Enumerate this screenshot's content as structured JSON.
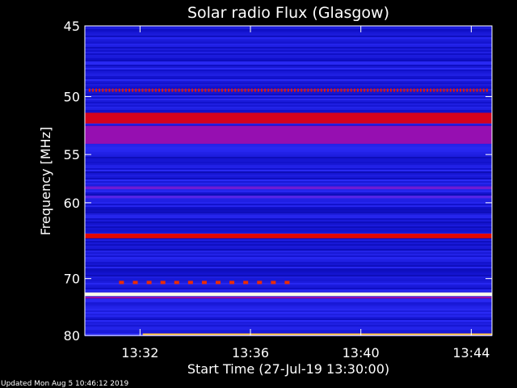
{
  "chart_data": {
    "type": "heatmap",
    "title": "Solar radio Flux (Glasgow)",
    "xlabel": "Start Time (27-Jul-19 13:30:00)",
    "ylabel": "Frequency [MHz]",
    "x_ticks": [
      "13:32",
      "13:36",
      "13:40",
      "13:44"
    ],
    "x_tick_minutes": [
      2,
      6,
      10,
      14
    ],
    "xlim_minutes": [
      0,
      14.75
    ],
    "y_ticks": [
      45,
      50,
      55,
      60,
      70,
      80
    ],
    "ylim": [
      45,
      80
    ],
    "y_scale": "reciprocal",
    "background_colour": "#1b1bd0",
    "colormap": [
      "#000060",
      "#1010c8",
      "#3030ff",
      "#9010c0",
      "#e00000",
      "#ff8000",
      "#ffe060",
      "#ffffff"
    ],
    "features": [
      {
        "kind": "band",
        "freq_start": 51.3,
        "freq_end": 52.2,
        "level": 0.55
      },
      {
        "kind": "band",
        "freq_start": 52.4,
        "freq_end": 54.0,
        "level": 0.44
      },
      {
        "kind": "band",
        "freq_start": 58.2,
        "freq_end": 58.5,
        "level": 0.38
      },
      {
        "kind": "band",
        "freq_start": 59.2,
        "freq_end": 59.5,
        "level": 0.34
      },
      {
        "kind": "band",
        "freq_start": 63.7,
        "freq_end": 64.3,
        "level": 0.58
      },
      {
        "kind": "band",
        "freq_start": 72.2,
        "freq_end": 72.8,
        "level": 0.98
      },
      {
        "kind": "band",
        "freq_start": 72.9,
        "freq_end": 73.2,
        "level": 0.45
      },
      {
        "kind": "band",
        "freq_start": 79.6,
        "freq_end": 80.0,
        "level": 0.8,
        "time_start": 2.1,
        "time_end": 14.75
      },
      {
        "kind": "dotted",
        "freq": 49.5,
        "level": 0.6,
        "time_start": 0.2,
        "time_end": 14.6,
        "spacing": 0.12
      },
      {
        "kind": "dotted",
        "freq": 70.6,
        "level": 0.62,
        "time_start": 1.3,
        "time_end": 7.3,
        "spacing": 0.5
      }
    ]
  },
  "footer": {
    "updated": "Updated Mon Aug  5 10:46:12 2019"
  }
}
